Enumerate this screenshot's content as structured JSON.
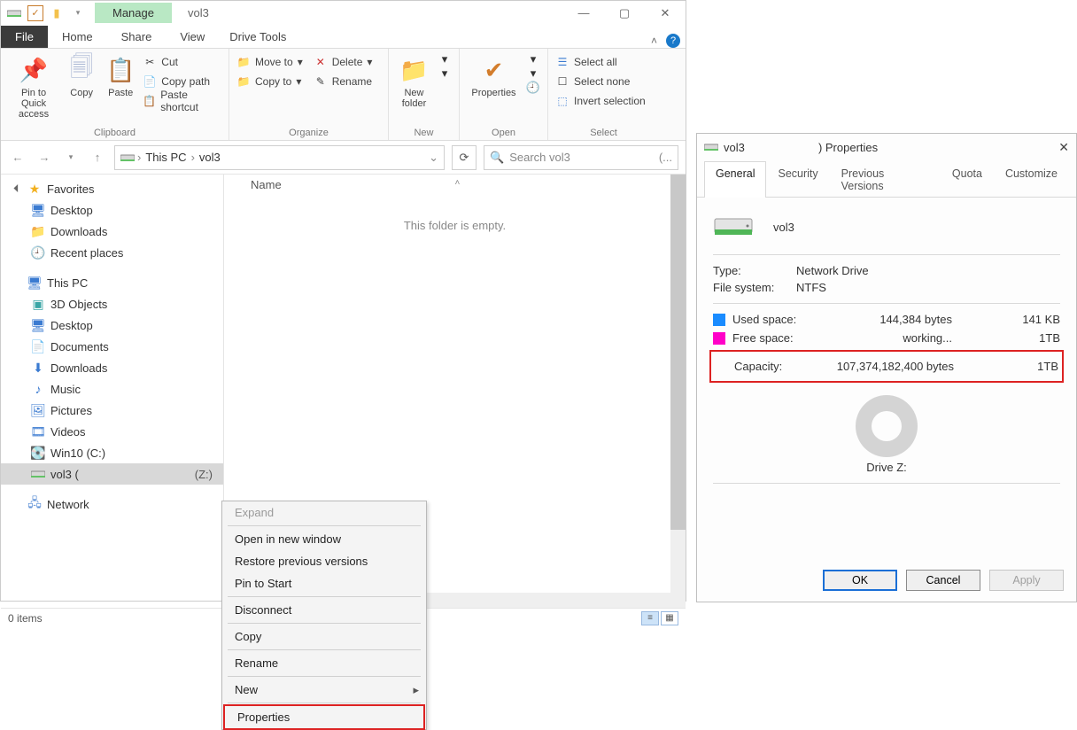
{
  "titlebar": {
    "manage": "Manage",
    "title": "vol3"
  },
  "window_controls": {
    "min": "—",
    "max": "▢",
    "close": "✕"
  },
  "tabs": {
    "file": "File",
    "home": "Home",
    "share": "Share",
    "view": "View",
    "drive_tools": "Drive Tools"
  },
  "ribbon": {
    "clipboard": {
      "label": "Clipboard",
      "pin": "Pin to Quick access",
      "copy": "Copy",
      "paste": "Paste",
      "cut": "Cut",
      "copy_path": "Copy path",
      "paste_shortcut": "Paste shortcut"
    },
    "organize": {
      "label": "Organize",
      "move_to": "Move to",
      "copy_to": "Copy to",
      "delete": "Delete",
      "rename": "Rename"
    },
    "new": {
      "label": "New",
      "new_folder": "New folder"
    },
    "open": {
      "label": "Open",
      "properties": "Properties"
    },
    "select": {
      "label": "Select",
      "select_all": "Select all",
      "select_none": "Select none",
      "invert": "Invert selection"
    }
  },
  "breadcrumb": {
    "root": "This PC",
    "current": "vol3"
  },
  "search": {
    "placeholder": "Search vol3"
  },
  "tree": {
    "favorites": "Favorites",
    "fav_items": [
      "Desktop",
      "Downloads",
      "Recent places"
    ],
    "this_pc": "This PC",
    "pc_items": [
      "3D Objects",
      "Desktop",
      "Documents",
      "Downloads",
      "Music",
      "Pictures",
      "Videos",
      "Win10 (C:)"
    ],
    "vol3": "vol3 (",
    "vol3_letter": "(Z:)",
    "network": "Network"
  },
  "list": {
    "column": "Name",
    "empty": "This folder is empty."
  },
  "status": {
    "items": "0 items"
  },
  "context_menu": {
    "expand": "Expand",
    "open_new_window": "Open in new window",
    "restore_prev": "Restore previous versions",
    "pin_start": "Pin to Start",
    "disconnect": "Disconnect",
    "copy": "Copy",
    "rename": "Rename",
    "new": "New",
    "properties": "Properties"
  },
  "props": {
    "title_prefix": "vol3",
    "title_suffix": ") Properties",
    "tabs": [
      "General",
      "Security",
      "Previous Versions",
      "Quota",
      "Customize"
    ],
    "drive_name": "vol3",
    "type_label": "Type:",
    "type_value": "Network Drive",
    "fs_label": "File system:",
    "fs_value": "NTFS",
    "used_label": "Used space:",
    "used_bytes": "144,384 bytes",
    "used_hr": "141 KB",
    "free_label": "Free space:",
    "free_bytes": "working...",
    "free_hr": "1TB",
    "cap_label": "Capacity:",
    "cap_bytes": "107,374,182,400 bytes",
    "cap_hr": "1TB",
    "drive_letter": "Drive Z:",
    "ok": "OK",
    "cancel": "Cancel",
    "apply": "Apply"
  }
}
